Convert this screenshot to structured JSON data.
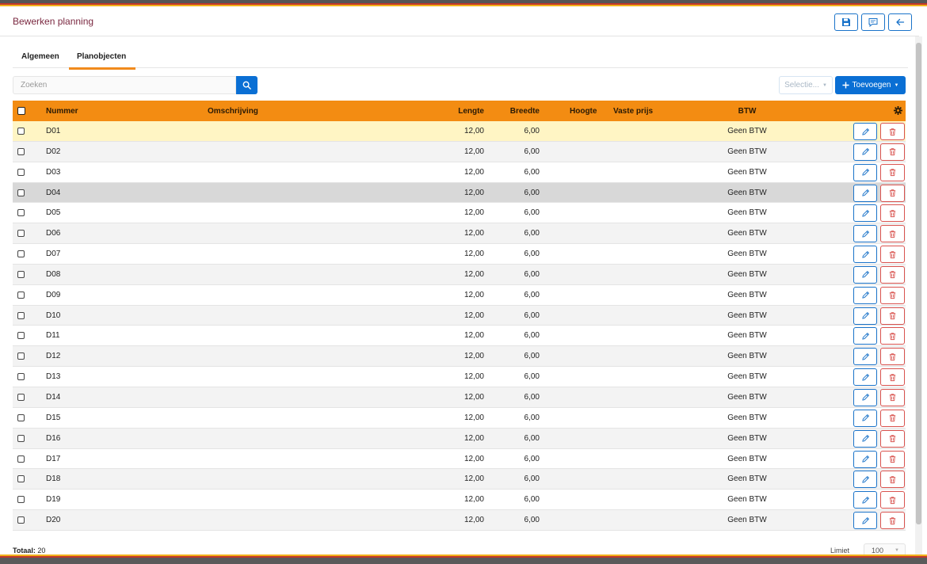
{
  "header": {
    "title": "Bewerken planning",
    "save_icon": "save-icon",
    "comment_icon": "comment-icon",
    "back_icon": "arrow-left-icon"
  },
  "tabs": [
    {
      "label": "Algemeen",
      "active": false
    },
    {
      "label": "Planobjecten",
      "active": true
    }
  ],
  "search": {
    "placeholder": "Zoeken",
    "value": ""
  },
  "toolbar": {
    "selectie_label": "Selectie...",
    "add_label": "Toevoegen"
  },
  "table": {
    "columns": [
      "Nummer",
      "Omschrijving",
      "Lengte",
      "Breedte",
      "Hoogte",
      "Vaste prijs",
      "BTW"
    ],
    "rows": [
      {
        "nummer": "D01",
        "lengte": "12,00",
        "breedte": "6,00",
        "btw": "Geen BTW"
      },
      {
        "nummer": "D02",
        "lengte": "12,00",
        "breedte": "6,00",
        "btw": "Geen BTW"
      },
      {
        "nummer": "D03",
        "lengte": "12,00",
        "breedte": "6,00",
        "btw": "Geen BTW"
      },
      {
        "nummer": "D04",
        "lengte": "12,00",
        "breedte": "6,00",
        "btw": "Geen BTW"
      },
      {
        "nummer": "D05",
        "lengte": "12,00",
        "breedte": "6,00",
        "btw": "Geen BTW"
      },
      {
        "nummer": "D06",
        "lengte": "12,00",
        "breedte": "6,00",
        "btw": "Geen BTW"
      },
      {
        "nummer": "D07",
        "lengte": "12,00",
        "breedte": "6,00",
        "btw": "Geen BTW"
      },
      {
        "nummer": "D08",
        "lengte": "12,00",
        "breedte": "6,00",
        "btw": "Geen BTW"
      },
      {
        "nummer": "D09",
        "lengte": "12,00",
        "breedte": "6,00",
        "btw": "Geen BTW"
      },
      {
        "nummer": "D10",
        "lengte": "12,00",
        "breedte": "6,00",
        "btw": "Geen BTW"
      },
      {
        "nummer": "D11",
        "lengte": "12,00",
        "breedte": "6,00",
        "btw": "Geen BTW"
      },
      {
        "nummer": "D12",
        "lengte": "12,00",
        "breedte": "6,00",
        "btw": "Geen BTW"
      },
      {
        "nummer": "D13",
        "lengte": "12,00",
        "breedte": "6,00",
        "btw": "Geen BTW"
      },
      {
        "nummer": "D14",
        "lengte": "12,00",
        "breedte": "6,00",
        "btw": "Geen BTW"
      },
      {
        "nummer": "D15",
        "lengte": "12,00",
        "breedte": "6,00",
        "btw": "Geen BTW"
      },
      {
        "nummer": "D16",
        "lengte": "12,00",
        "breedte": "6,00",
        "btw": "Geen BTW"
      },
      {
        "nummer": "D17",
        "lengte": "12,00",
        "breedte": "6,00",
        "btw": "Geen BTW"
      },
      {
        "nummer": "D18",
        "lengte": "12,00",
        "breedte": "6,00",
        "btw": "Geen BTW"
      },
      {
        "nummer": "D19",
        "lengte": "12,00",
        "breedte": "6,00",
        "btw": "Geen BTW"
      },
      {
        "nummer": "D20",
        "lengte": "12,00",
        "breedte": "6,00",
        "btw": "Geen BTW"
      }
    ],
    "highlighted_row": "D01",
    "hovered_row": "D04"
  },
  "footer": {
    "total_label": "Totaal:",
    "total_value": "20",
    "limit_label": "Limiet",
    "limit_value": "100"
  },
  "colors": {
    "accent": "#f38c12",
    "primary": "#0a6fd4",
    "danger": "#d9534f",
    "title": "#7a2840"
  }
}
